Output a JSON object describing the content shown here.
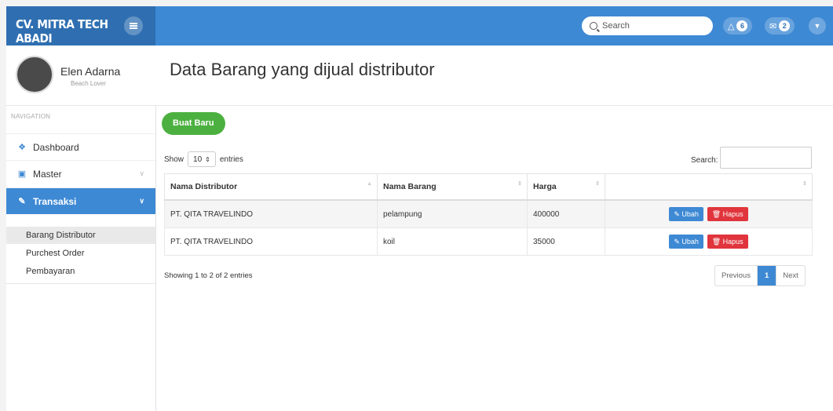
{
  "app": {
    "brand": "CV. MITRA TECH ABADI",
    "search_placeholder": "Search",
    "notifications_count": "6",
    "messages_count": "2"
  },
  "user": {
    "name": "Elen Adarna",
    "subtitle": "Beach Lover"
  },
  "sidebar": {
    "header": "NAVIGATION",
    "items": [
      {
        "label": "Dashboard",
        "icon": "home-icon"
      },
      {
        "label": "Master",
        "icon": "briefcase-icon"
      },
      {
        "label": "Transaksi",
        "icon": "edit-icon",
        "active": true
      }
    ],
    "subitems": [
      {
        "label": "Barang Distributor",
        "current": true
      },
      {
        "label": "Purchest Order"
      },
      {
        "label": "Pembayaran"
      }
    ]
  },
  "page": {
    "title": "Data Barang yang dijual distributor",
    "new_button": "Buat Baru"
  },
  "table_controls": {
    "show_label": "Show",
    "entries_value": "10",
    "entries_label": "entries",
    "search_label": "Search:"
  },
  "table": {
    "headers": [
      "Nama Distributor",
      "Nama Barang",
      "Harga",
      ""
    ],
    "rows": [
      {
        "distributor": "PT. QITA TRAVELINDO",
        "barang": "pelampung",
        "harga": "400000"
      },
      {
        "distributor": "PT. QITA TRAVELINDO",
        "barang": "koil",
        "harga": "35000"
      }
    ],
    "edit_label": "Ubah",
    "delete_label": "Hapus"
  },
  "footer": {
    "info": "Showing 1 to 2 of 2 entries",
    "previous": "Previous",
    "current_page": "1",
    "next": "Next"
  },
  "colors": {
    "topbar": "#3e89d4",
    "brand_bg": "#2f6fb1",
    "success": "#4cb040",
    "danger": "#e0353c"
  }
}
